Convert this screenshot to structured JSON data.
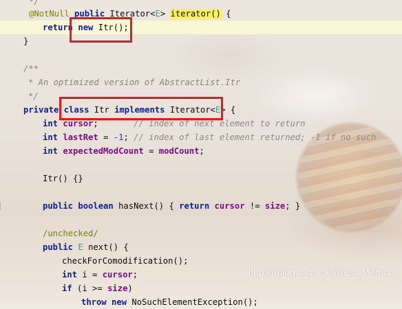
{
  "colors": {
    "keyword": "#0b1e9b",
    "field": "#7b0d87",
    "comment": "#8a8a8a",
    "annotation": "#808000",
    "type_param": "#24a6a0",
    "method_highlight": "#f6f15c",
    "red_box": "#e01b1b"
  },
  "code": {
    "l0": "*/",
    "l1": {
      "ann": "@NotNull",
      "kw": "public",
      "type": "Iterator<",
      "tp": "E",
      "type_end": ">",
      "method": "iterator()",
      "brace": "{"
    },
    "l2": {
      "kw1": "return",
      "kw2": "new",
      "rest": "Itr();"
    },
    "l3": "}",
    "l4": "/**",
    "l5": "* An optimized version of AbstractList.Itr",
    "l6": "*/",
    "l7": {
      "kw1": "private",
      "kw2": "class",
      "name": "Itr",
      "kw3": "implements",
      "type": "Iterator<",
      "tp": "E",
      "type_end": ">",
      "brace": "{"
    },
    "l8": {
      "kw": "int",
      "field": "cursor",
      "semi": ";",
      "comment": "// index of next element to return"
    },
    "l9": {
      "kw": "int",
      "field": "lastRet",
      "eq": " = ",
      "num": "-1",
      "semi": ";",
      "comment": "// index of last element returned; -1 if no such"
    },
    "l10": {
      "kw": "int",
      "field": "expectedModCount",
      "eq": " = ",
      "field2": "modCount",
      "semi": ";"
    },
    "l11": "Itr() {}",
    "l12": {
      "kw1": "public",
      "kw2": "boolean",
      "name": "hasNext() { ",
      "kw3": "return",
      "field1": "cursor",
      "op": " != ",
      "field2": "size",
      "end": "; }"
    },
    "l13": "/unchecked/",
    "l14": {
      "kw": "public",
      "tp": "E",
      "rest": "next() {"
    },
    "l15": "checkForComodification();",
    "l16": {
      "kw": "int",
      "rest": "i = ",
      "field": "cursor",
      "semi": ";"
    },
    "l17": {
      "kw": "if",
      "rest": "(i >= ",
      "field": "size",
      "end": ")"
    },
    "l18": {
      "kw1": "throw",
      "kw2": "new",
      "rest": "NoSuchElementException();"
    }
  },
  "watermark": "https://blog.csdn.net/Best_Memory"
}
